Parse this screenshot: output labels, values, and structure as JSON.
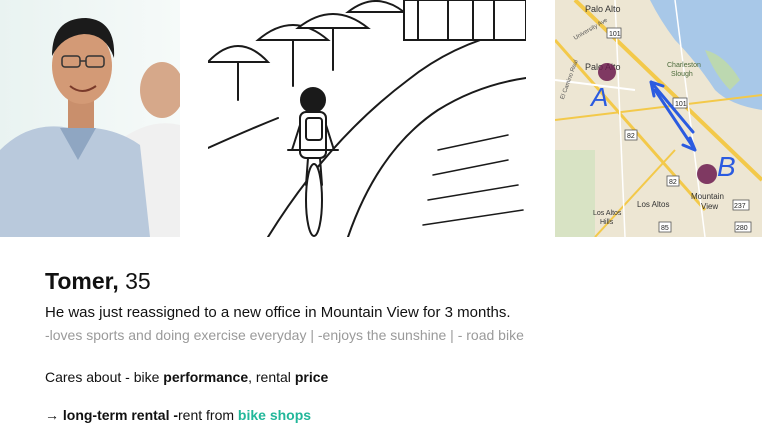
{
  "persona": {
    "name": "Tomer,",
    "age": "35",
    "intro": "He was just reassigned to a new office in Mountain View for 3 months.",
    "traits": "-loves sports and doing exercise everyday | -enjoys the sunshine | - road bike",
    "cares_prefix": "Cares about - bike ",
    "cares_term1": "performance",
    "cares_sep": ", rental ",
    "cares_term2": "price",
    "arrow": "→",
    "rental_label": "long-term rental -",
    "rental_text": "rent from ",
    "rental_link": "bike shops"
  },
  "map": {
    "labels": {
      "palo_alto_top": "Palo Alto",
      "palo_alto": "Palo Alto",
      "mountain_view": "Mountain",
      "mountain_view_2": "View",
      "los_altos": "Los Altos",
      "los_altos_hills": "Los Altos",
      "los_altos_hills_2": "Hills",
      "charleston": "Charleston",
      "slough": "Slough",
      "route_101_a": "101",
      "route_101_b": "101",
      "route_82_a": "82",
      "route_82_b": "82",
      "route_85": "85",
      "route_237": "237",
      "route_280": "280",
      "el_camino": "El Camino Real",
      "university": "University Ave"
    },
    "marker_a": "A",
    "marker_b": "B"
  },
  "colors": {
    "accent": "#22b79a",
    "trait_gray": "#9a9a9a",
    "map_ink": "#2b5be0",
    "marker": "#6b1a4d"
  }
}
